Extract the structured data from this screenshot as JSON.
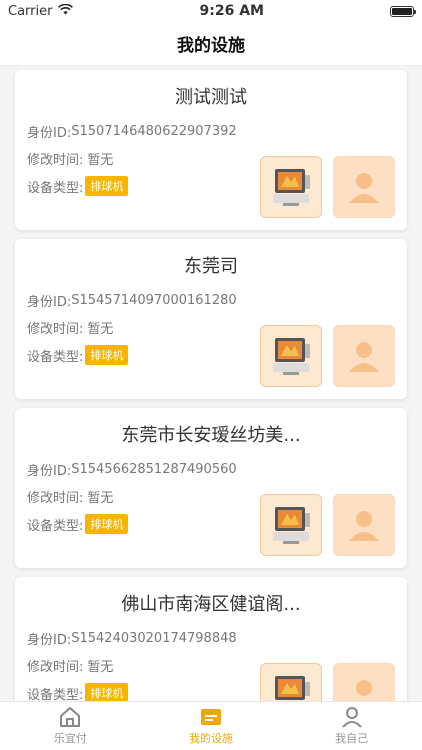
{
  "status_bar": {
    "carrier": "Carrier",
    "time": "9:26 AM"
  },
  "header": {
    "title": "我的设施"
  },
  "labels": {
    "id": "身份ID:",
    "modified": "修改时间:",
    "type": "设备类型:"
  },
  "facilities": [
    {
      "name": "测试测试",
      "id": "S1507146480622907392",
      "modified": "暂无",
      "type": "排球机"
    },
    {
      "name": "东莞司",
      "id": "S1545714097000161280",
      "modified": "暂无",
      "type": "排球机"
    },
    {
      "name": "东莞市长安瑷丝坊美...",
      "id": "S1545662851287490560",
      "modified": "暂无",
      "type": "排球机"
    },
    {
      "name": "佛山市南海区健谊阁...",
      "id": "S1542403020174798848",
      "modified": "暂无",
      "type": "排球机"
    }
  ],
  "tabbar": {
    "items": [
      {
        "label": "乐宜付",
        "icon": "home-icon",
        "active": false
      },
      {
        "label": "我的设施",
        "icon": "facility-icon",
        "active": true
      },
      {
        "label": "我自己",
        "icon": "user-icon",
        "active": false
      }
    ]
  },
  "colors": {
    "accent": "#f0a800",
    "tag": "#f7b500",
    "thumb_bg": "#fde8d2"
  }
}
